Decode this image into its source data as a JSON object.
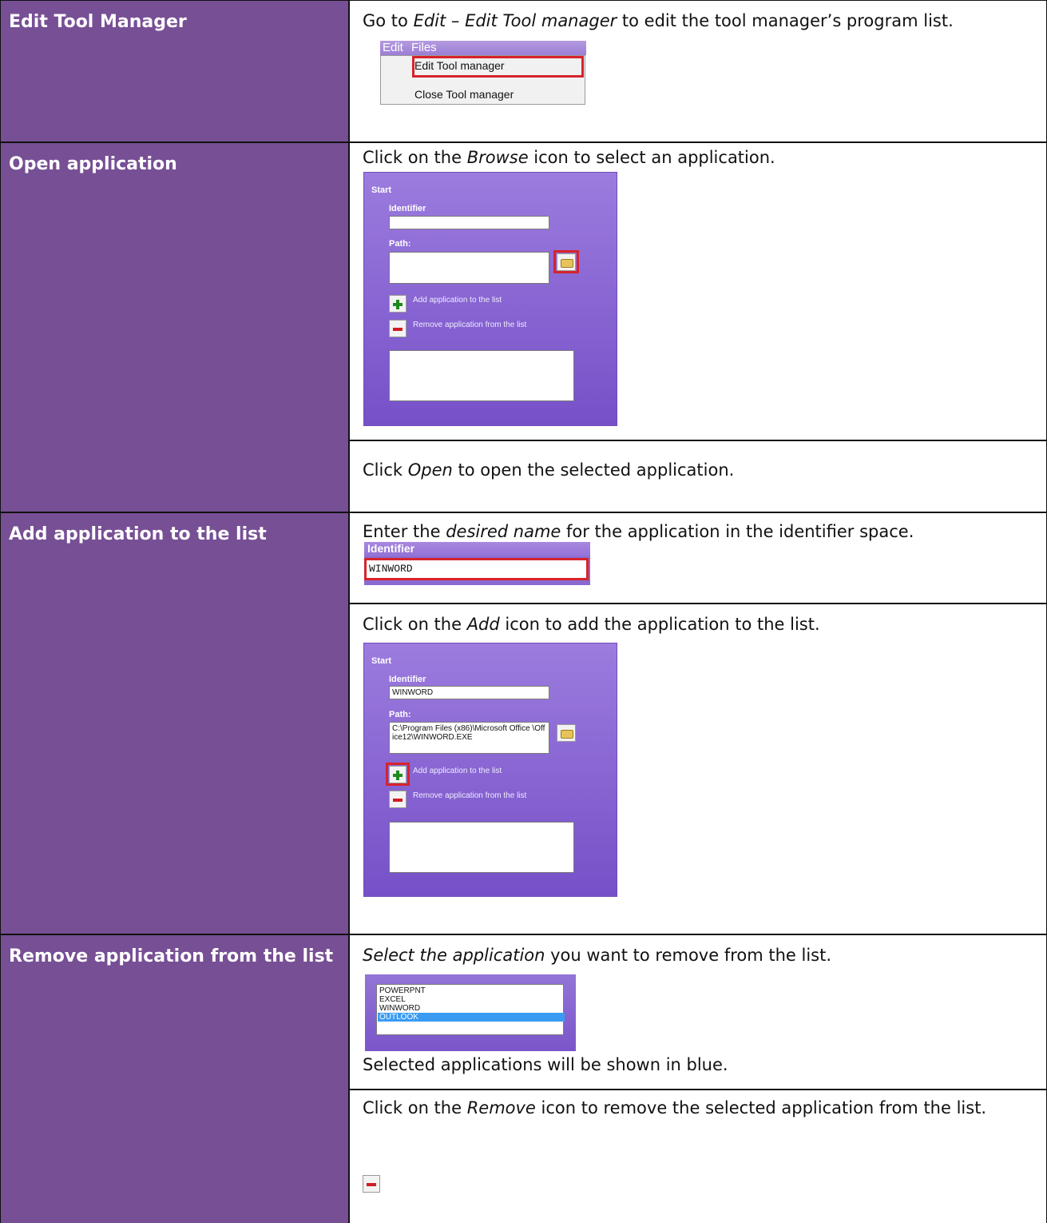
{
  "sections": [
    {
      "title": "Edit Tool Manager"
    },
    {
      "title": "Open application"
    },
    {
      "title": "Add application to the list"
    },
    {
      "title": "Remove application from the list"
    }
  ],
  "s1": {
    "text_a": "Go to ",
    "text_b": "Edit – Edit Tool manager",
    "text_c": " to edit the tool manager’s program list.",
    "menu": {
      "edit": "Edit",
      "files": "Files",
      "item1": "Edit Tool manager",
      "item2": "Close Tool manager"
    }
  },
  "s2": {
    "text1_a": "Click on the ",
    "text1_b": "Browse",
    "text1_c": " icon to select an application.",
    "text2_a": "Click ",
    "text2_b": "Open",
    "text2_c": " to open the selected application."
  },
  "panel": {
    "start": "Start",
    "identifier": "Identifier",
    "path": "Path:",
    "add_label": "Add application to the list",
    "remove_label": "Remove application from the list"
  },
  "s3": {
    "text1_a": "Enter the ",
    "text1_b": "desired name",
    "text1_c": " for the application in the identifier space.",
    "id_label": "Identifier",
    "id_value": "WINWORD",
    "text2_a": "Click on the ",
    "text2_b": "Add",
    "text2_c": " icon to add the application to the list.",
    "filled_identifier": "WINWORD",
    "filled_path": "C:\\Program Files (x86)\\Microsoft Office \\Office12\\WINWORD.EXE"
  },
  "s4": {
    "text1_a": "Select the application",
    "text1_b": " you want to remove from the list.",
    "list": [
      "POWERPNT",
      "EXCEL",
      "WINWORD",
      "OUTLOOK"
    ],
    "text2": "Selected applications will be shown in blue.",
    "text3_a": "Click on the ",
    "text3_b": "Remove",
    "text3_c": " icon to remove the selected application from the list."
  },
  "colors": {
    "left_bg": "#774f94",
    "highlight": "#d7232b",
    "selected": "#3a9bf3"
  }
}
